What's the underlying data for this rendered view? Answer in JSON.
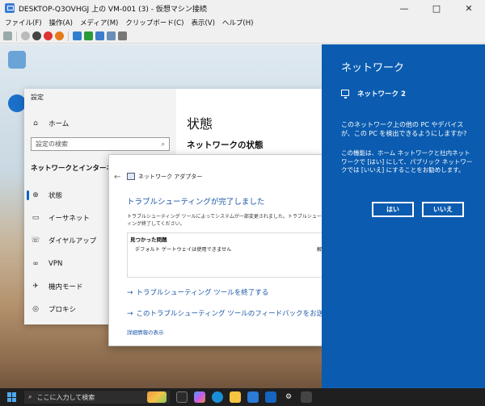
{
  "window": {
    "title": "DESKTOP-Q3OVHGJ 上の VM-001 (3) - 仮想マシン接続",
    "minimize": "—",
    "maximize": "□",
    "close": "✕"
  },
  "menu": [
    "ファイル(F)",
    "操作(A)",
    "メディア(M)",
    "クリップボード(C)",
    "表示(V)",
    "ヘルプ(H)"
  ],
  "settings": {
    "title": "設定",
    "home": "ホーム",
    "search_placeholder": "設定の検索",
    "section": "ネットワークとインターネット",
    "nav": [
      "状態",
      "イーサネット",
      "ダイヤルアップ",
      "VPN",
      "機内モード",
      "プロキシ"
    ],
    "page_title": "状態",
    "page_subtitle": "ネットワークの状態"
  },
  "troubleshooter": {
    "back": "←",
    "title": "ネットワーク アダプター",
    "heading": "トラブルシューティングが完了しました",
    "desc": "トラブルシューティング ツールによってシステムが一部変更されました。トラブルシューティング終了してください。",
    "found_header": "見つかった問題",
    "problem": "デフォルト ゲートウェイは使用できません",
    "problem_status": "解決済",
    "close_link": "トラブルシューティング ツールを終了する",
    "feedback_link": "このトラブルシューティング ツールのフィードバックをお送りください",
    "detail_link": "詳細情報の表示"
  },
  "flyout": {
    "title": "ネットワーク",
    "network_name": "ネットワーク 2",
    "question": "このネットワーク上の他の PC やデバイスが、この PC を検出できるようにしますか?",
    "info": "この機能は、ホーム ネットワークと社内ネットワークで [はい] にして、パブリック ネットワークでは [いいえ] にすることをお勧めします。",
    "yes": "はい",
    "no": "いいえ"
  },
  "taskbar": {
    "search_placeholder": "ここに入力して検索"
  },
  "colors": {
    "flyout_bg": "#0b5cb0",
    "link": "#1a56a8",
    "accent": "#0067c0"
  }
}
